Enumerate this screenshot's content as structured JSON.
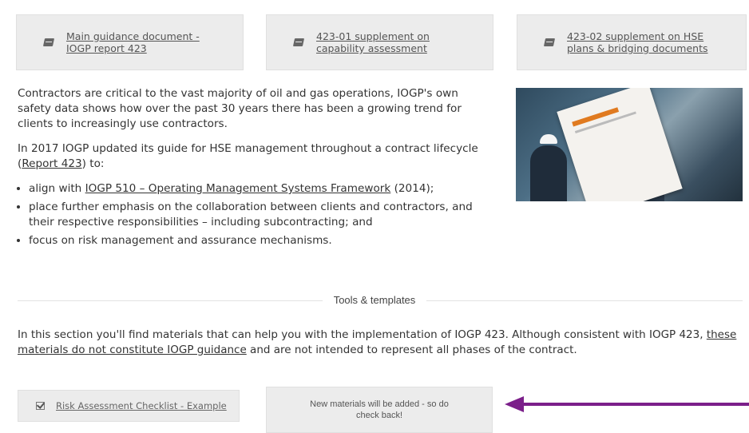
{
  "top_cards": [
    {
      "label_line1": "Main guidance document -",
      "label_line2": "IOGP report 423",
      "icon": "document-icon"
    },
    {
      "label_line1": "423-01 supplement on",
      "label_line2": "capability assessment",
      "icon": "document-icon"
    },
    {
      "label_line1": "423-02 supplement on HSE",
      "label_line2": "plans & bridging documents",
      "icon": "document-icon"
    }
  ],
  "intro": {
    "p1": "Contractors are critical to the vast majority of oil and gas operations, IOGP's own safety data shows how over the past 30 years there has been a growing trend for clients to increasingly use contractors.",
    "p2_before": "In 2017 IOGP updated its guide for HSE management throughout a contract lifecycle (",
    "p2_link": "Report 423",
    "p2_after": ") to:",
    "bullets": {
      "b1_before": "align with ",
      "b1_link": "IOGP 510 – Operating Management Systems Framework",
      "b1_after": " (2014);",
      "b2": "place further emphasis on the collaboration between clients and contractors, and their respective responsibilities – including subcontracting; and",
      "b3": "focus on risk management and assurance mechanisms."
    }
  },
  "divider_label": "Tools & templates",
  "section": {
    "text_before": "In this section you'll find materials that can help you with the implementation of IOGP 423. Although consistent with IOGP 423, ",
    "link": "these materials do not constitute IOGP guidance",
    "text_after": " and are not  intended to represent all phases of the contract."
  },
  "bottom_cards": {
    "checklist_label": "Risk Assessment Checklist - Example",
    "message": "New materials will be added - so do check back!"
  },
  "colors": {
    "card_bg": "#ececec",
    "arrow": "#7b1f8a"
  }
}
